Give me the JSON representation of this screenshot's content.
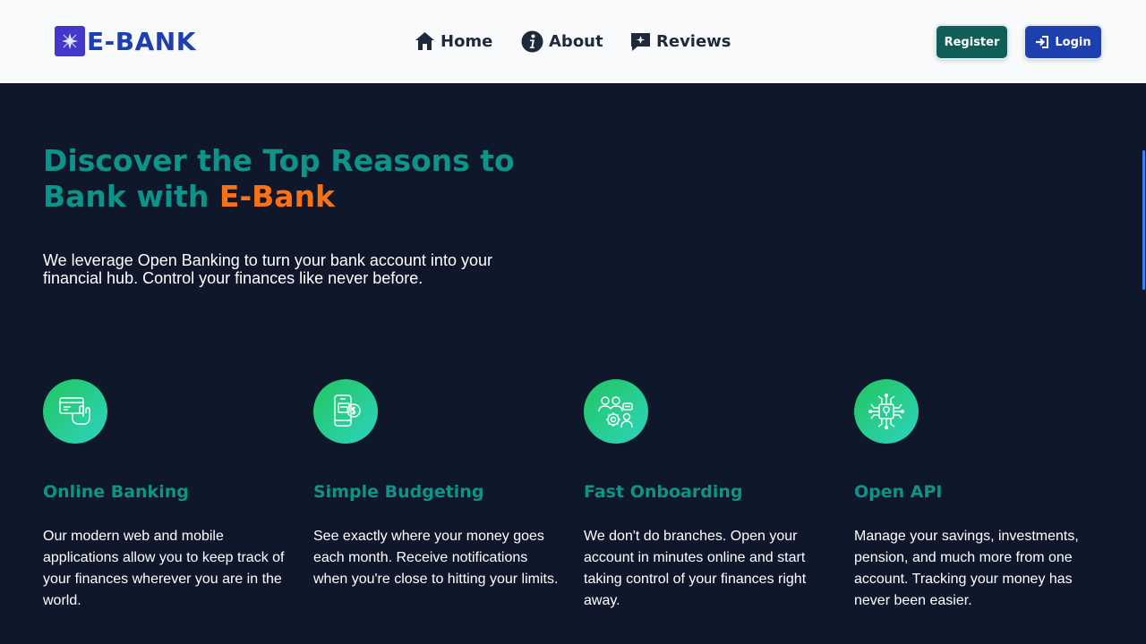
{
  "header": {
    "logo_text": "E-BANK",
    "nav": [
      {
        "label": "Home",
        "icon": "home-icon"
      },
      {
        "label": "About",
        "icon": "info-icon"
      },
      {
        "label": "Reviews",
        "icon": "chat-star-icon"
      }
    ],
    "register_label": "Register",
    "login_label": "Login"
  },
  "hero": {
    "title_main": "Discover the Top Reasons to Bank with ",
    "title_accent": "E-Bank",
    "subtitle": "We leverage Open Banking to turn your bank account into your financial hub. Control your finances like never before."
  },
  "features": [
    {
      "title": "Online Banking",
      "description": "Our modern web and mobile applications allow you to keep track of your finances wherever you are in the world.",
      "icon": "card-hand-icon"
    },
    {
      "title": "Simple Budgeting",
      "description": "See exactly where your money goes each month. Receive notifications when you're close to hitting your limits.",
      "icon": "phone-money-icon"
    },
    {
      "title": "Fast Onboarding",
      "description": "We don't do branches. Open your account in minutes online and start taking control of your finances right away.",
      "icon": "team-gear-icon"
    },
    {
      "title": "Open API",
      "description": "Manage your savings, investments, pension, and much more from one account. Tracking your money has never been easier.",
      "icon": "chip-network-icon"
    }
  ],
  "colors": {
    "header_bg": "#f8fafc",
    "page_bg": "#0f172a",
    "heading_teal": "#0d9488",
    "accent_orange": "#f97316",
    "register_bg": "#115e59",
    "login_bg": "#1e40af"
  }
}
